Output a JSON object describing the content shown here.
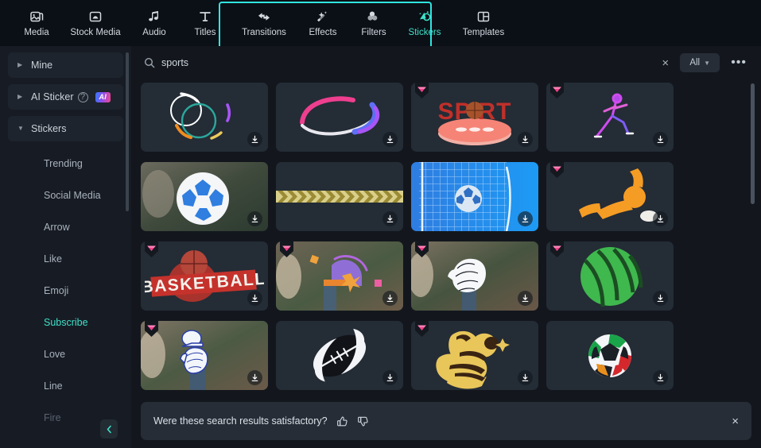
{
  "toolbar": {
    "items": [
      {
        "label": "Media",
        "icon": "media-icon",
        "active": false
      },
      {
        "label": "Stock Media",
        "icon": "stock-media-icon",
        "active": false
      },
      {
        "label": "Audio",
        "icon": "audio-icon",
        "active": false
      },
      {
        "label": "Titles",
        "icon": "titles-icon",
        "active": false
      },
      {
        "label": "Transitions",
        "icon": "transitions-icon",
        "active": false
      },
      {
        "label": "Effects",
        "icon": "effects-icon",
        "active": false
      },
      {
        "label": "Filters",
        "icon": "filters-icon",
        "active": false
      },
      {
        "label": "Stickers",
        "icon": "stickers-icon",
        "active": true
      },
      {
        "label": "Templates",
        "icon": "templates-icon",
        "active": false
      }
    ],
    "highlight_color": "#2ee6e0",
    "active_color": "#3fe0c8"
  },
  "sidebar": {
    "groups": [
      {
        "label": "Mine",
        "expanded": false,
        "badge": null
      },
      {
        "label": "AI Sticker",
        "expanded": false,
        "badge": "AI",
        "help": "?"
      },
      {
        "label": "Stickers",
        "expanded": true,
        "badge": null
      }
    ],
    "items": [
      {
        "label": "Trending",
        "state": "normal"
      },
      {
        "label": "Social Media",
        "state": "normal"
      },
      {
        "label": "Arrow",
        "state": "normal"
      },
      {
        "label": "Like",
        "state": "normal"
      },
      {
        "label": "Emoji",
        "state": "normal"
      },
      {
        "label": "Subscribe",
        "state": "active"
      },
      {
        "label": "Love",
        "state": "normal"
      },
      {
        "label": "Line",
        "state": "normal"
      },
      {
        "label": "Fire",
        "state": "faded"
      }
    ],
    "collapse_icon": "chevron-left-icon"
  },
  "search": {
    "query": "sports",
    "placeholder": "Search",
    "clear_label": "×",
    "filter_value": "All",
    "more_label": "•••"
  },
  "grid": {
    "tiles": [
      {
        "name": "circles-swirl-sticker",
        "premium": false,
        "art": "circles"
      },
      {
        "name": "pink-blue-swoosh-sticker",
        "premium": false,
        "art": "swoosh"
      },
      {
        "name": "sport-3d-text-sticker",
        "premium": true,
        "art": "sport3d"
      },
      {
        "name": "neon-runner-sticker",
        "premium": true,
        "art": "runner"
      },
      {
        "name": "soccer-ball-photo-sticker",
        "premium": false,
        "art": "soccerball"
      },
      {
        "name": "yellow-chevron-line-sticker",
        "premium": false,
        "art": "chevrons"
      },
      {
        "name": "goal-net-sticker",
        "premium": false,
        "art": "goalnet"
      },
      {
        "name": "orange-sliding-player-sticker",
        "premium": true,
        "art": "slider"
      },
      {
        "name": "basketball-text-sticker",
        "premium": true,
        "art": "basketball"
      },
      {
        "name": "purple-hoop-doodle-sticker",
        "premium": true,
        "art": "hoop"
      },
      {
        "name": "baseball-glove-doodle-sticker",
        "premium": true,
        "art": "glove"
      },
      {
        "name": "green-striped-ball-sticker",
        "premium": true,
        "art": "greenball"
      },
      {
        "name": "baseball-cap-glove-sticker",
        "premium": true,
        "art": "capglove"
      },
      {
        "name": "black-white-football-sticker",
        "premium": false,
        "art": "football"
      },
      {
        "name": "sports-fitness-lettering-sticker",
        "premium": true,
        "art": "lettering"
      },
      {
        "name": "colorful-soccer-ball-sticker",
        "premium": false,
        "art": "colorball"
      }
    ]
  },
  "feedback": {
    "question": "Were these search results satisfactory?",
    "thumbs_up": "thumbs-up-icon",
    "thumbs_down": "thumbs-down-icon",
    "close": "×"
  }
}
